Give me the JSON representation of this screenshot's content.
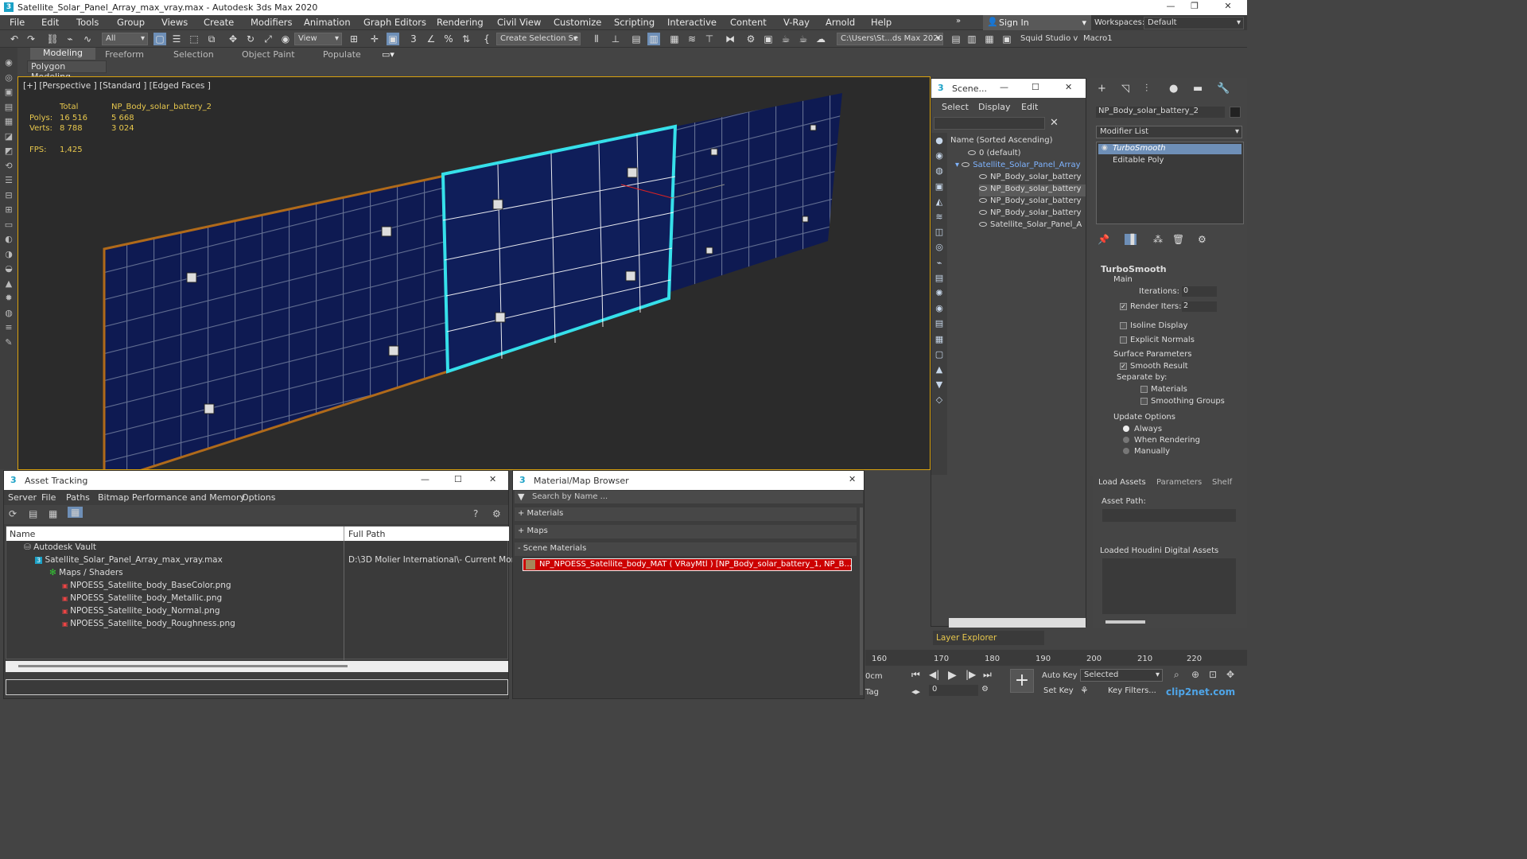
{
  "window": {
    "title": "Satellite_Solar_Panel_Array_max_vray.max - Autodesk 3ds Max 2020"
  },
  "menu": [
    "File",
    "Edit",
    "Tools",
    "Group",
    "Views",
    "Create",
    "Modifiers",
    "Animation",
    "Graph Editors",
    "Rendering",
    "Civil View",
    "Customize",
    "Scripting",
    "Interactive",
    "Content",
    "V-Ray",
    "Arnold",
    "Help"
  ],
  "signin": "Sign In",
  "workspace": {
    "label": "Workspaces:",
    "value": "Default"
  },
  "toolbar": {
    "filter": "All",
    "refcoord": "View",
    "selset": "Create Selection Se",
    "path": "C:\\Users\\St...ds Max 2020",
    "squid": "Squid Studio v",
    "macro": "Macro1"
  },
  "ribbon": {
    "tabs": [
      "Modeling",
      "Freeform",
      "Selection",
      "Object Paint",
      "Populate"
    ],
    "sub": "Polygon Modeling"
  },
  "viewport": {
    "label": "[+] [Perspective ] [Standard ] [Edged Faces ]",
    "stats": {
      "total": "Total",
      "object": "NP_Body_solar_battery_2",
      "polys_label": "Polys:",
      "polys_total": "16 516",
      "polys_obj": "5 668",
      "verts_label": "Verts:",
      "verts_total": "8 788",
      "verts_obj": "3 024",
      "fps_label": "FPS:",
      "fps": "1,425"
    }
  },
  "scene_explorer": {
    "title": "Scene...",
    "menus": [
      "Select",
      "Display",
      "Edit"
    ],
    "column": "Name (Sorted Ascending)",
    "rows": [
      "0 (default)",
      "Satellite_Solar_Panel_Array",
      "NP_Body_solar_battery",
      "NP_Body_solar_battery",
      "NP_Body_solar_battery",
      "NP_Body_solar_battery",
      "Satellite_Solar_Panel_A"
    ],
    "layer_explorer": "Layer Explorer"
  },
  "modify": {
    "object_name": "NP_Body_solar_battery_2",
    "modifier_list": "Modifier List",
    "stack": [
      "TurboSmooth",
      "Editable Poly"
    ],
    "rollout": "TurboSmooth",
    "main": "Main",
    "iterations_label": "Iterations:",
    "iterations": "0",
    "render_iters_label": "Render Iters:",
    "render_iters": "2",
    "isoline": "Isoline Display",
    "explicit": "Explicit Normals",
    "surface": "Surface Parameters",
    "smooth_result": "Smooth Result",
    "separate": "Separate by:",
    "materials": "Materials",
    "smoothing": "Smoothing Groups",
    "update": "Update Options",
    "always": "Always",
    "when_rendering": "When Rendering",
    "manually": "Manually"
  },
  "houdini": {
    "tabs": [
      "Load Assets",
      "Parameters",
      "Shelf"
    ],
    "asset_path": "Asset Path:",
    "loaded": "Loaded Houdini Digital Assets"
  },
  "asset_tracking": {
    "title": "Asset Tracking",
    "menus": [
      "Server",
      "File",
      "Paths",
      "Bitmap Performance and Memory",
      "Options"
    ],
    "col_name": "Name",
    "col_path": "Full Path",
    "rows": [
      {
        "name": "Autodesk Vault",
        "path": ""
      },
      {
        "name": "Satellite_Solar_Panel_Array_max_vray.max",
        "path": "D:\\3D Molier International\\- Current Mor"
      },
      {
        "name": "Maps / Shaders",
        "path": ""
      },
      {
        "name": "NPOESS_Satellite_body_BaseColor.png",
        "path": ""
      },
      {
        "name": "NPOESS_Satellite_body_Metallic.png",
        "path": ""
      },
      {
        "name": "NPOESS_Satellite_body_Normal.png",
        "path": ""
      },
      {
        "name": "NPOESS_Satellite_body_Roughness.png",
        "path": ""
      }
    ]
  },
  "material_browser": {
    "title": "Material/Map Browser",
    "search": "Search by Name ...",
    "groups": [
      "+ Materials",
      "+ Maps",
      "- Scene Materials"
    ],
    "item": "NP_NPOESS_Satellite_body_MAT ( VRayMtl ) [NP_Body_solar_battery_1, NP_B..."
  },
  "timeline": {
    "ticks": [
      "160",
      "170",
      "180",
      "190",
      "200",
      "210",
      "220"
    ],
    "unit": "0cm",
    "tag": "Tag",
    "frame": "0",
    "autokey": "Auto Key",
    "setkey": "Set Key",
    "selected": "Selected",
    "keyfilters": "Key Filters...",
    "watermark": "clip2net.com"
  }
}
